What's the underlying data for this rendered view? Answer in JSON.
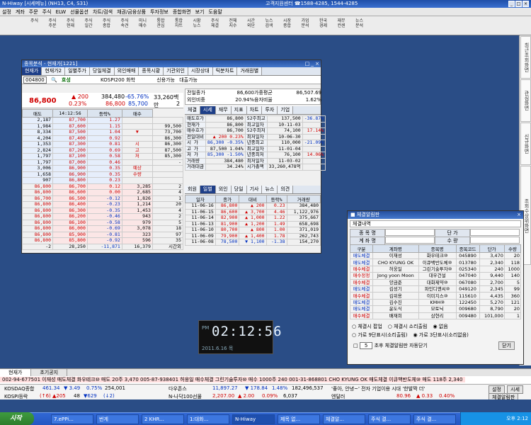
{
  "app": {
    "title": "N-Hiway  [시세메뉴] (NH13, C4, S31)",
    "center": "고객지원센터 ☎1588-4285, 1544-4285"
  },
  "menu": [
    "설정",
    "계좌",
    "주문",
    "주식",
    "ELW",
    "선물옵션",
    "차트/검색",
    "채권/금융상품",
    "투자정보",
    "종합화면",
    "보기",
    "도움말"
  ],
  "screen_code": "1221",
  "toolbar": [
    "주식",
    "주식\n주문",
    "주식\n현재",
    "주식\n일간",
    "주식\n종합",
    "주식\n속견",
    "미니\n매수",
    "통합\n관심",
    "통합\n차트",
    "시황\n뉴스",
    "주식\n체결",
    "전체\n지수",
    "시간\n외단",
    "뉴스\n검색",
    "시장\n종합",
    "가업\n분석",
    "한국\n경제",
    "재무\n컨센",
    "뉴스\n분석"
  ],
  "rpanel": [
    "최근조회화면",
    "관심화면",
    "신규화면",
    "조회수상위화면"
  ],
  "mainwin": {
    "title": "종목분석 - 현재가[1221]",
    "tabs": [
      "현재가",
      "현재가2",
      "일별주가",
      "당일체결",
      "외인매매",
      "종목시황",
      "기관외인",
      "시장상대",
      "틱분차트",
      "거래원별"
    ],
    "code": "004800",
    "name": "효성",
    "market": "KOSPI200 화학",
    "credit": "신용가능",
    "loan": "대출가능",
    "price": "86,800",
    "change": "▲ 200",
    "rate": "0.23%",
    "volume": "384,480",
    "vol_rate": "-65.76%",
    "vol_unit": "대",
    "amount": "33,260백만",
    "high": "86,800",
    "low": "85,700",
    "vol_label": "체",
    "vol_val": "2",
    "time": "14:12:56",
    "ask_head": [
      "매도",
      "14:12:56",
      "등락%",
      "매수"
    ],
    "asks": [
      [
        "2,187",
        "87,700",
        "1.27"
      ],
      [
        "1,984",
        "87,600",
        "1.15"
      ],
      [
        "8,334",
        "87,500",
        "1.04"
      ],
      [
        "4,204",
        "87,400",
        "0.92"
      ],
      [
        "1,353",
        "87,300",
        "0.81"
      ],
      [
        "2,824",
        "87,200",
        "0.69"
      ],
      [
        "1,797",
        "87,100",
        "0.58"
      ],
      [
        "1,797",
        "87,000",
        "0.46"
      ],
      [
        "3,006",
        "86,900",
        "0.35"
      ],
      [
        "1,658",
        "86,900",
        "0.35"
      ],
      [
        "907",
        "86,800",
        "0.23"
      ]
    ],
    "bid_side": [
      [
        "",
        ""
      ],
      [
        "",
        "99,500"
      ],
      [
        "▼",
        "73,700"
      ],
      [
        "",
        "86,300"
      ],
      [
        "시",
        "86,300"
      ],
      [
        "고",
        "87,500"
      ],
      [
        "저",
        "85,300"
      ],
      [
        "",
        "-"
      ],
      [
        "예상",
        ""
      ],
      [
        "수량",
        ""
      ],
      [
        "",
        ""
      ]
    ],
    "bids": [
      [
        "86,700",
        "0.12",
        "3,285"
      ],
      [
        "86,600",
        "0.00",
        "2,685"
      ],
      [
        "86,500",
        "-0.12",
        "1,826"
      ],
      [
        "86,400",
        "-0.23",
        "1,214"
      ],
      [
        "86,300",
        "-0.35",
        "1,453"
      ],
      [
        "86,200",
        "-0.46",
        "943"
      ],
      [
        "86,100",
        "-0.58",
        "979"
      ],
      [
        "86,000",
        "-0.69",
        "3,078"
      ],
      [
        "85,900",
        "-0.81",
        "323"
      ],
      [
        "85,800",
        "-0.92",
        "596"
      ]
    ],
    "sum": [
      "28,250",
      "-11,871",
      "16,379"
    ],
    "after": "시간외",
    "trade_head": [
      "체결가",
      "체결량"
    ],
    "trades": [
      [
        "86,800",
        "2"
      ],
      [
        "86,800",
        "4"
      ],
      [
        "86,700",
        "1"
      ],
      [
        "86,800",
        "20"
      ],
      [
        "86,800",
        "4"
      ],
      [
        "86,800",
        "2"
      ],
      [
        "86,800",
        "5"
      ],
      [
        "86,800",
        "18"
      ],
      [
        "86,800",
        "97"
      ],
      [
        "86,800",
        "35"
      ]
    ],
    "trade_sum": "-2",
    "info": [
      [
        "전일종가",
        "86,600",
        "가중평균",
        "86,507.69"
      ],
      [
        "외인비중",
        "20.94%",
        "융자비율",
        "1.62%"
      ]
    ],
    "subtabs": [
      "체결",
      "시세",
      "재무",
      "지표",
      "차트",
      "투자",
      "기업"
    ],
    "detail": [
      [
        "매도호가",
        "86,800",
        "52주최고",
        "137,500",
        "-36.87%"
      ],
      [
        "현재가",
        "86,800",
        "최고일자",
        "10-11-03",
        ""
      ],
      [
        "매수호가",
        "86,700",
        "52주최저",
        "74,100",
        "17.14%"
      ],
      [
        "전일대비",
        "▲ 200  0.23%",
        "최저일자",
        "10-06-30",
        ""
      ],
      [
        "시 가",
        "86,300 -0.35%",
        "년중최고",
        "110,000",
        "-21.09%"
      ],
      [
        "고 가",
        "87,500  1.04%",
        "최고일자",
        "11-01-04",
        ""
      ],
      [
        "저 가",
        "85,300 -1.50%",
        "년중최저",
        "76,100",
        "14.06%"
      ],
      [
        "거래량",
        "384,480",
        "최저일자",
        "11-03-02",
        ""
      ],
      [
        "거래대금",
        "34.24%",
        "시가총액",
        "33,260,478억",
        ""
      ]
    ],
    "daytabs": [
      "회원",
      "일별",
      "외인",
      "당일",
      "기사",
      "뉴스",
      "의견"
    ],
    "day_head": [
      "일자",
      "종가",
      "대비",
      "등락%",
      "거래량"
    ],
    "days": [
      [
        "11-06-16",
        "86,800",
        "▲ 200",
        "0.23",
        "384,480"
      ],
      [
        "11-06-15",
        "86,600",
        "▲ 3,700",
        "4.46",
        "1,122,976"
      ],
      [
        "11-06-14",
        "82,900",
        "▲ 1,000",
        "1.22",
        "375,667"
      ],
      [
        "11-06-13",
        "81,900",
        "▲ 1,200",
        "1.49",
        "658,698"
      ],
      [
        "11-06-10",
        "80,700",
        "▲ 800",
        "1.00",
        "371,019"
      ],
      [
        "11-06-09",
        "79,900",
        "▲ 1,400",
        "1.78",
        "262,743"
      ],
      [
        "11-06-08",
        "78,500",
        "▼ 1,100",
        "-1.38",
        "154,270"
      ]
    ]
  },
  "clock": {
    "ampm": "PM",
    "time": "02:12:56",
    "date": "2011.6.16 목"
  },
  "notify": {
    "title": "체결알림판",
    "sub": "체결내역",
    "labels": [
      "종 목 명",
      "단 가",
      "계 좌 명",
      "수 량"
    ],
    "head": [
      "구분",
      "계좌명",
      "종목명",
      "종목코드",
      "단가",
      "수량"
    ],
    "rows": [
      [
        "매도체결",
        "이재성",
        "화우테크⑩",
        "045890",
        "3,470",
        "20"
      ],
      [
        "매도체결",
        "CHO KYUNG OK",
        "이큐백반도체⑩",
        "013780",
        "2,340",
        "118"
      ],
      [
        "매수체결",
        "허웅일",
        "그린기술투자⑩",
        "025340",
        "240",
        "1000"
      ],
      [
        "매수정정",
        "Jong yoon Moon",
        "대우건설",
        "047040",
        "9,440",
        "140"
      ],
      [
        "매수체결",
        "양금준",
        "대화제약⑩",
        "067080",
        "2,700",
        "5"
      ],
      [
        "매도체결",
        "김성기",
        "파인디앤씨⑩",
        "049120",
        "2,345",
        "99"
      ],
      [
        "매수체결",
        "김위용",
        "이미지스⑩",
        "115610",
        "4,435",
        "360"
      ],
      [
        "매도체결",
        "김수진",
        "KMH⑩",
        "122450",
        "5,270",
        "121"
      ],
      [
        "매도체결",
        "윤도식",
        "모토닉",
        "009680",
        "8,790",
        "20"
      ],
      [
        "매수체결",
        "배재희",
        "삼현리",
        "009480",
        "101,000",
        "1"
      ]
    ],
    "opts": [
      "체결시 팝업",
      "체결시 소리출림",
      "없음",
      "가로 9단표시(소리출림)",
      "가로 3단표시(소리없음)"
    ],
    "sec": "5",
    "sec_label": "초후 체결알림판 자동닫기",
    "close": "닫기"
  },
  "bottom": {
    "tabs": [
      "현재가",
      "초기공지"
    ],
    "ticker": "002-94-677501 이재성 매도체결 화우테크⑩ 매도 20주 3,470      005-87-938401 허웅일 매수체결 그린기술투자⑩ 매수 1000주 240      001-31-868801 CHO KYUNG OK 매도체결 이큐백반도체⑩ 매도 118주 2,340",
    "idx1": [
      "KOSDAQ종합",
      "461.34",
      "▼ 3.49",
      "0.75%",
      "254,001"
    ],
    "idx2": [
      "KOSPI등락",
      "(↑6)",
      "▲205",
      "48",
      "▼629",
      "(↓2)"
    ],
    "mid1": [
      "다우존스",
      "11,897.27",
      "▼ 178.84",
      "1.48%",
      "182,496,537"
    ],
    "mid2": [
      "N-나닥100선물",
      "2,207.00",
      "▲ 2.00",
      "0.09%",
      "6,037"
    ],
    "news": "'좋아, 안녕~' 전자 기업이용 시대 '한발짝 더'",
    "intl": [
      "엔달러",
      "80.96",
      "▲ 0.33",
      "0.40%"
    ],
    "buttons": [
      "설정",
      "시세",
      "체결알림판"
    ]
  },
  "taskbar": {
    "start": "시작",
    "items": [
      "7.ePPi...",
      "번게",
      "2 KHR...",
      "1:대화...",
      "N-Hiway",
      "제목 없...",
      "체결알...",
      "주식 결...",
      "주식 결..."
    ],
    "time": "오후 2:12"
  }
}
